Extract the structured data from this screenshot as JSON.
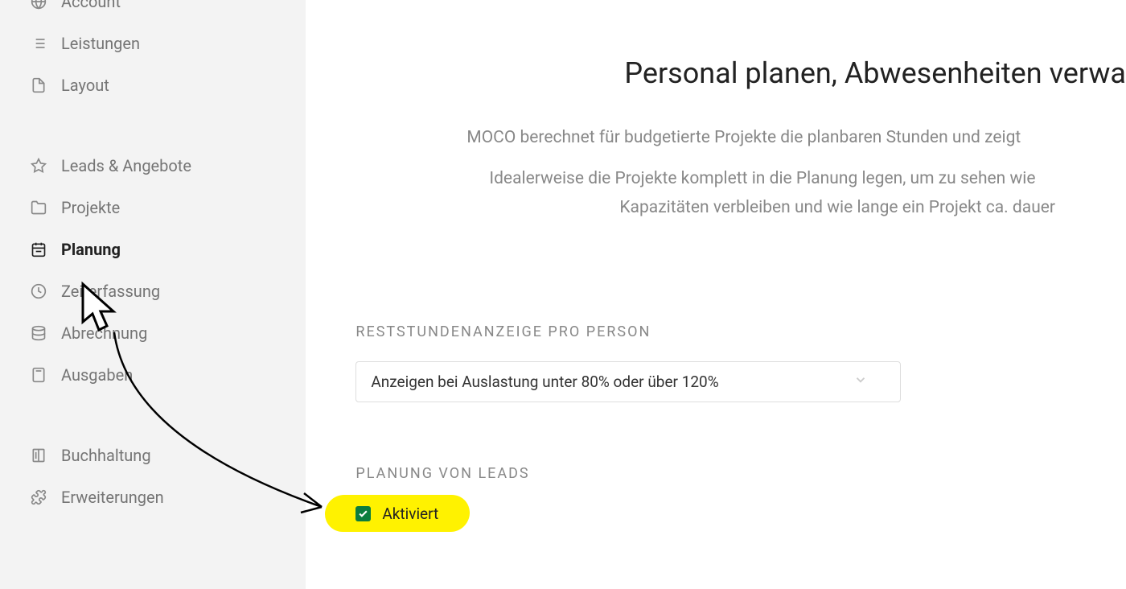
{
  "sidebar": {
    "items": [
      {
        "label": "Account",
        "icon": "globe"
      },
      {
        "label": "Leistungen",
        "icon": "list"
      },
      {
        "label": "Layout",
        "icon": "file"
      },
      {
        "label": "Leads & Angebote",
        "icon": "star"
      },
      {
        "label": "Projekte",
        "icon": "folder"
      },
      {
        "label": "Planung",
        "icon": "calendar",
        "active": true
      },
      {
        "label": "Zeiterfassung",
        "icon": "clock"
      },
      {
        "label": "Abrechnung",
        "icon": "database"
      },
      {
        "label": "Ausgaben",
        "icon": "calculator"
      },
      {
        "label": "Buchhaltung",
        "icon": "book"
      },
      {
        "label": "Erweiterungen",
        "icon": "puzzle"
      }
    ]
  },
  "main": {
    "title": "Personal planen, Abwesenheiten verwa",
    "lead1": "MOCO berechnet für budgetierte Projekte die planbaren Stunden und zeigt ",
    "lead2": "Idealerweise die Projekte komplett in die Planung legen, um zu sehen wie",
    "lead3": "Kapazitäten verbleiben und wie lange ein Projekt ca. dauer",
    "section_reststunden": "Reststundenanzeige pro Person",
    "select_value": "Anzeigen bei Auslastung unter 80% oder über 120%",
    "section_leads": "Planung von Leads",
    "checkbox_label": "Aktiviert"
  }
}
